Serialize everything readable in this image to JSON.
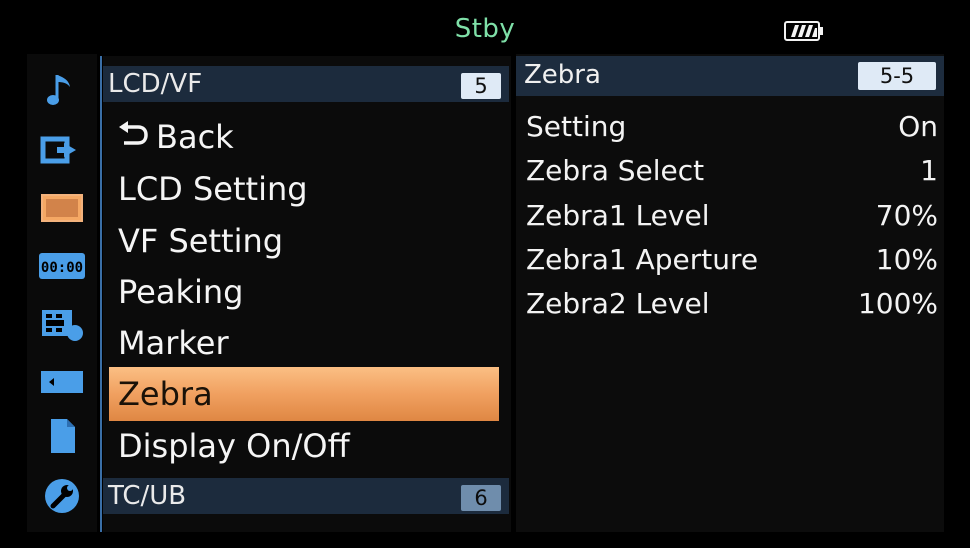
{
  "status": {
    "mode": "Stby",
    "battery_icon": "battery-full-icon"
  },
  "rail": {
    "icons": [
      {
        "name": "audio-note-icon",
        "selected": false
      },
      {
        "name": "output-icon",
        "selected": false
      },
      {
        "name": "display-lcd-vf-icon",
        "selected": true
      },
      {
        "name": "timecode-icon",
        "label": "00:00",
        "selected": false
      },
      {
        "name": "camera-film-icon",
        "selected": false
      },
      {
        "name": "media-card-icon",
        "selected": false
      },
      {
        "name": "file-icon",
        "selected": false
      },
      {
        "name": "maintenance-wrench-icon",
        "selected": false
      }
    ]
  },
  "menu": {
    "header": {
      "label": "LCD/VF",
      "num": "5"
    },
    "back_label": "Back",
    "items": [
      {
        "label": "LCD Setting",
        "selected": false
      },
      {
        "label": "VF Setting",
        "selected": false
      },
      {
        "label": "Peaking",
        "selected": false
      },
      {
        "label": "Marker",
        "selected": false
      },
      {
        "label": "Zebra",
        "selected": true
      },
      {
        "label": "Display On/Off",
        "selected": false
      }
    ],
    "footer": {
      "label": "TC/UB",
      "num": "6"
    }
  },
  "panel": {
    "title": "Zebra",
    "page": "5-5",
    "rows": [
      {
        "name": "Setting",
        "value": "On"
      },
      {
        "name": "Zebra Select",
        "value": "1"
      },
      {
        "name": "Zebra1 Level",
        "value": "70%"
      },
      {
        "name": "Zebra1 Aperture",
        "value": "10%"
      },
      {
        "name": "Zebra2 Level",
        "value": "100%"
      }
    ]
  },
  "colors": {
    "status_text": "#7fe0a8",
    "selection": "#f0a060",
    "header_bg": "#1c2b3d",
    "divider": "#3a6fa7"
  }
}
